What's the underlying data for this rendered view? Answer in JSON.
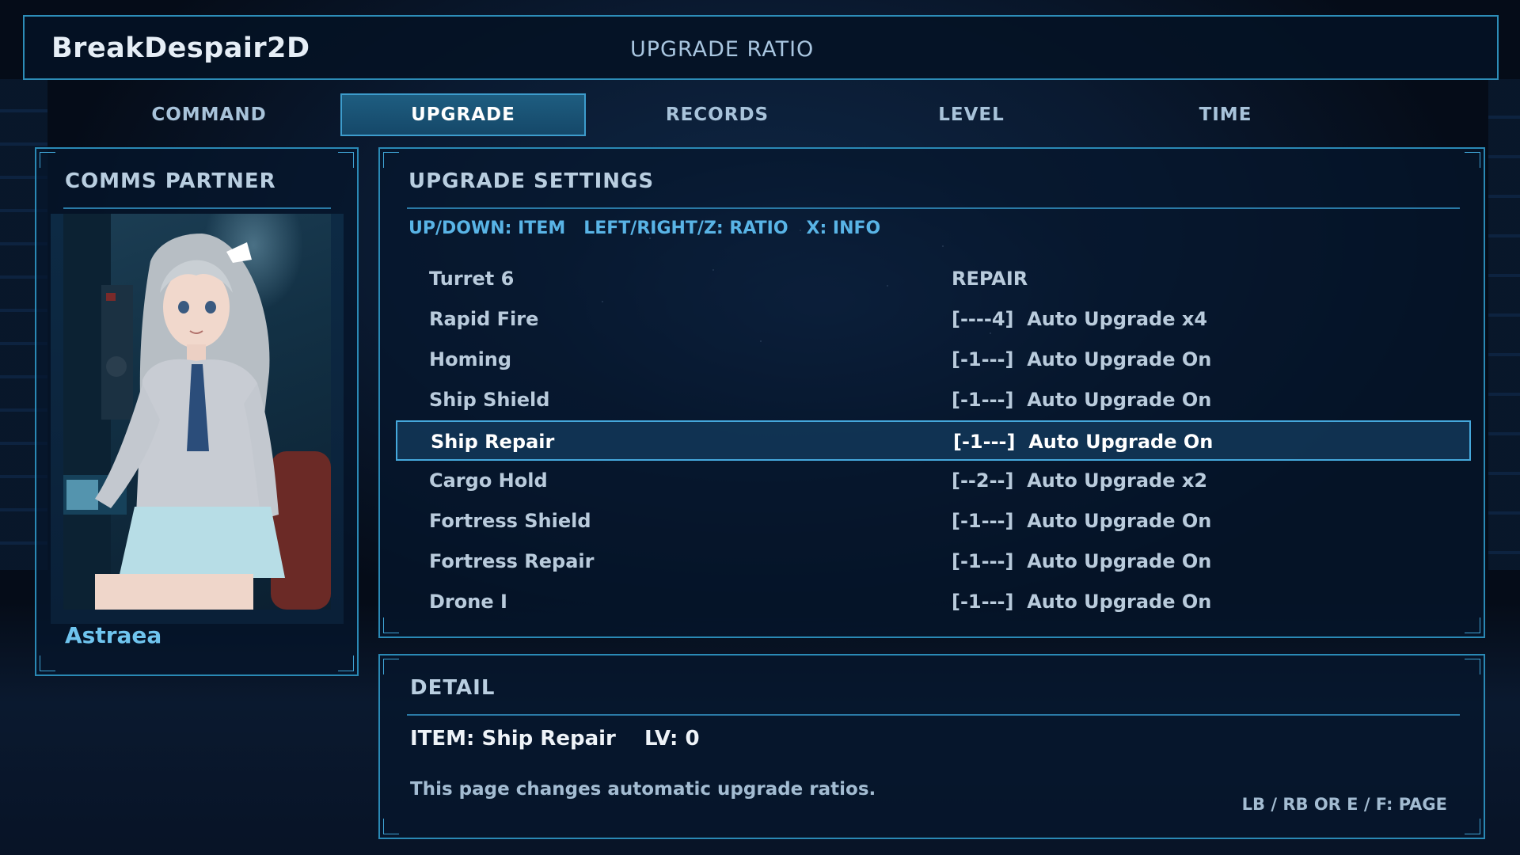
{
  "header": {
    "game_title": "BreakDespair2D",
    "page_title": "UPGRADE RATIO"
  },
  "tabs": [
    {
      "label": "COMMAND",
      "active": false
    },
    {
      "label": "UPGRADE",
      "active": true
    },
    {
      "label": "RECORDS",
      "active": false
    },
    {
      "label": "LEVEL",
      "active": false
    },
    {
      "label": "TIME",
      "active": false
    }
  ],
  "comms": {
    "title": "COMMS PARTNER",
    "partner_name": "Astraea"
  },
  "upgrade_settings": {
    "title": "UPGRADE SETTINGS",
    "controls_hint": "UP/DOWN: ITEM   LEFT/RIGHT/Z: RATIO   X: INFO",
    "rows": [
      {
        "name": "Turret 6",
        "value": "REPAIR",
        "selected": false
      },
      {
        "name": "Rapid Fire",
        "value": "[----4]  Auto Upgrade x4",
        "selected": false
      },
      {
        "name": "Homing",
        "value": "[-1---]  Auto Upgrade On",
        "selected": false
      },
      {
        "name": "Ship Shield",
        "value": "[-1---]  Auto Upgrade On",
        "selected": false
      },
      {
        "name": "Ship Repair",
        "value": "[-1---]  Auto Upgrade On",
        "selected": true
      },
      {
        "name": "Cargo Hold",
        "value": "[--2--]  Auto Upgrade x2",
        "selected": false
      },
      {
        "name": "Fortress Shield",
        "value": "[-1---]  Auto Upgrade On",
        "selected": false
      },
      {
        "name": "Fortress Repair",
        "value": "[-1---]  Auto Upgrade On",
        "selected": false
      },
      {
        "name": "Drone I",
        "value": "[-1---]  Auto Upgrade On",
        "selected": false
      }
    ]
  },
  "detail": {
    "title": "DETAIL",
    "item_line": "ITEM: Ship Repair    LV: 0",
    "description": "This page changes automatic upgrade ratios.",
    "page_hint": "LB / RB OR E / F: PAGE"
  },
  "colors": {
    "frame": "#2a89b5",
    "accent": "#59b4e6",
    "selected_border": "#45a8dc"
  }
}
